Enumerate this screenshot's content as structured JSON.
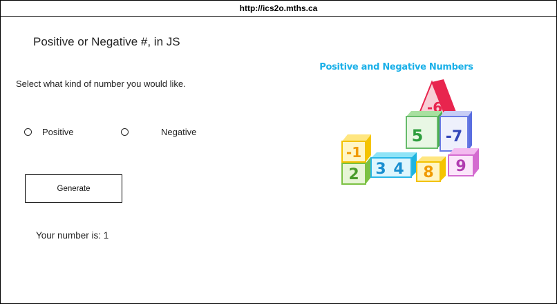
{
  "browser": {
    "url": "http://ics2o.mths.ca"
  },
  "page": {
    "title": "Positive or Negative #, in JS",
    "prompt": "Select what kind of number you would like.",
    "options": [
      {
        "label": "Positive",
        "selected": false
      },
      {
        "label": "Negative",
        "selected": false
      }
    ],
    "generate_label": "Generate",
    "result_text": "Your number is: 1"
  },
  "image": {
    "title": "Positive and Negative Numbers",
    "blocks": [
      "-6",
      "5",
      "-7",
      "-1",
      "2",
      "3",
      "4",
      "8",
      "9"
    ]
  },
  "colors": {
    "hero_title": "#1ab0e8",
    "border": "#000000"
  }
}
